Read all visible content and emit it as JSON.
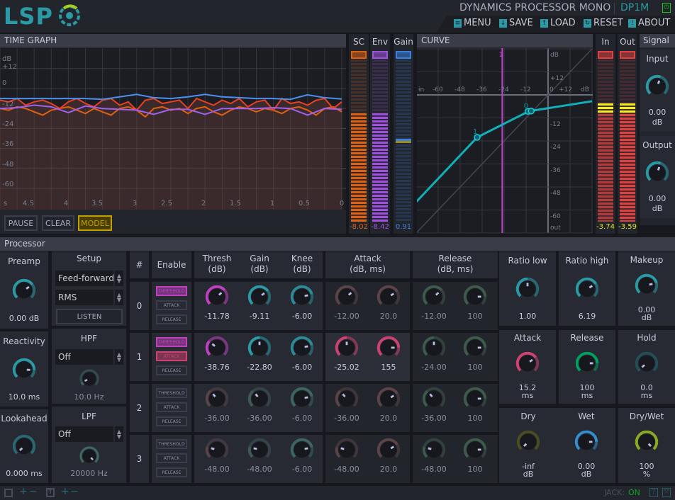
{
  "header": {
    "logo": "LSP",
    "title": "DYNAMICS PROCESSOR MONO",
    "code": "DP1M",
    "menu": [
      {
        "label": "MENU",
        "icon": "menu-icon"
      },
      {
        "label": "SAVE",
        "icon": "save-icon"
      },
      {
        "label": "LOAD",
        "icon": "load-icon"
      },
      {
        "label": "RESET",
        "icon": "reset-icon"
      },
      {
        "label": "ABOUT",
        "icon": "about-icon"
      }
    ],
    "power_color": "#20c020"
  },
  "time_graph": {
    "title": "TIME GRAPH",
    "y_labels": [
      "dB",
      "+12",
      "0",
      "-12",
      "-24",
      "-36",
      "-48",
      "-60"
    ],
    "x_labels": [
      "s",
      "4.5",
      "4",
      "3.5",
      "3",
      "2.5",
      "2",
      "1.5",
      "1",
      "0.5",
      "0"
    ],
    "x_range_s": [
      5,
      0
    ],
    "y_range_db": [
      -72,
      24
    ],
    "series": {
      "out": {
        "color": "#4a90f0",
        "values": [
          -6,
          -6,
          -6,
          -6,
          -6,
          -6,
          -6.5,
          -5,
          -3.5,
          -5.5,
          -6,
          -5,
          -3.5,
          -5,
          -5.5,
          -6,
          -6,
          -6.5,
          -3.8,
          -5.5,
          -6.3
        ]
      },
      "env": {
        "color": "#a060f0",
        "values": [
          -12,
          -11.5,
          -10,
          -11,
          -14.5,
          -10.5,
          -12,
          -12.5,
          -13,
          -15.5,
          -12.5,
          -12.5,
          -15.5,
          -12,
          -12,
          -12,
          -11.5,
          -12,
          -16,
          -12,
          -12.5
        ]
      },
      "in": {
        "color": "#e84020",
        "values": [
          -7,
          -8,
          -6,
          -10,
          -8,
          -7,
          -9,
          -12,
          -8,
          -6,
          -9,
          -11,
          -7,
          -6,
          -10,
          -8,
          -13,
          -7,
          -6,
          -9,
          -8,
          -7,
          -12,
          -6,
          -8,
          -10,
          -7,
          -9,
          -6,
          -11,
          -8,
          -7,
          -13,
          -6,
          -9,
          -8,
          -10,
          -7,
          -6,
          -12,
          -8
        ]
      },
      "sc": {
        "color": "#e06010",
        "values": [
          -12,
          -13,
          -11,
          -12,
          -14,
          -16,
          -13,
          -12,
          -11,
          -13,
          -15,
          -12,
          -14,
          -16,
          -12,
          -11,
          -13,
          -17,
          -12,
          -11,
          -13,
          -12,
          -15,
          -12,
          -11,
          -14,
          -16,
          -13,
          -11,
          -12,
          -14,
          -12,
          -13,
          -15,
          -12,
          -11,
          -13,
          -16,
          -12,
          -11,
          -14
        ]
      }
    },
    "buttons": {
      "pause": "PAUSE",
      "clear": "CLEAR",
      "model": "MODEL"
    }
  },
  "meters": {
    "sc": {
      "label": "SC",
      "value": "-8.02",
      "level": 0.67,
      "color": "#e06010"
    },
    "env": {
      "label": "Env",
      "value": "-8.42",
      "level": 0.67,
      "color": "#a050e0"
    },
    "gain": {
      "label": "Gain",
      "value": "0.91",
      "level": 0.51,
      "color": "#3a80e0"
    },
    "in": {
      "label": "In",
      "value": "-3.74",
      "level": 0.73,
      "color": "#e04040"
    },
    "out": {
      "label": "Out",
      "value": "-3.59",
      "level": 0.73,
      "color": "#e04040"
    }
  },
  "curve": {
    "title": "CURVE",
    "x_labels": [
      "in",
      "-60",
      "-48",
      "-36",
      "-24",
      "-12",
      "0",
      "+12",
      "dB"
    ],
    "y_labels": [
      "dB",
      "+12",
      "-12",
      "-24",
      "-36",
      "-48",
      "-60",
      "out"
    ],
    "range_db": [
      -72,
      24
    ],
    "points": [
      [
        -72,
        -55.8
      ],
      [
        -38.7,
        -22.1
      ],
      [
        -10.5,
        -8.5
      ],
      [
        24,
        -3.3
      ]
    ],
    "handles": [
      {
        "label": "1",
        "in": -38.7,
        "out": -22.1
      },
      {
        "label": "0",
        "in": -11,
        "out": -8.6
      },
      {
        "label": "",
        "in": -9.2,
        "out": -8.4
      }
    ],
    "marker": {
      "label": "1",
      "in": -25.02,
      "color": "#c040d0"
    },
    "color": "#10b0b8"
  },
  "signal": {
    "title": "Signal",
    "input": {
      "label": "Input",
      "value": "0.00",
      "unit": "dB",
      "pos": 0.57,
      "color": "#2a9aa5"
    },
    "output": {
      "label": "Output",
      "value": "0.00",
      "unit": "dB",
      "pos": 0.57,
      "color": "#2a9aa5"
    }
  },
  "processor": {
    "title": "Processor",
    "preamp": {
      "label": "Preamp",
      "value": "0.00 dB",
      "pos": 0.7,
      "color": "#2a9aa5"
    },
    "reactivity": {
      "label": "Reactivity",
      "value": "10.0 ms",
      "pos": 0.84,
      "color": "#2a9aa5"
    },
    "lookahead": {
      "label": "Lookahead",
      "value": "0.000 ms",
      "pos": 0.0,
      "color": "#2a9aa5"
    },
    "setup": {
      "label": "Setup",
      "mode": "Feed-forward",
      "type": "RMS",
      "listen": "LISTEN"
    },
    "hpf": {
      "label": "HPF",
      "mode": "Off",
      "value": "10.0 Hz",
      "pos": 0.08,
      "color": "#3e6660"
    },
    "lpf": {
      "label": "LPF",
      "mode": "Off",
      "value": "20000 Hz",
      "pos": 1.0,
      "color": "#3e6660"
    },
    "columns": {
      "num": "#",
      "enable": "Enable",
      "thresh": "Thresh\n(dB)",
      "gain": "Gain\n(dB)",
      "knee": "Knee\n(dB)",
      "attack": "Attack\n(dB, ms)",
      "release": "Release\n(dB, ms)"
    },
    "enable_labels": [
      "THRESHOLD",
      "ATTACK",
      "RELEASE"
    ],
    "rows": [
      {
        "num": "0",
        "enabled": [
          true,
          false,
          false
        ],
        "thresh": {
          "value": "-11.78",
          "pos": 0.68
        },
        "gain": {
          "value": "-9.11",
          "pos": 0.7
        },
        "knee": {
          "value": "-6.00",
          "pos": 0.78
        },
        "att_db": {
          "value": "-12.00",
          "pos": 0.68
        },
        "att_ms": {
          "value": "20.0",
          "pos": 0.72
        },
        "rel_db": {
          "value": "-12.00",
          "pos": 0.68
        },
        "rel_ms": {
          "value": "100",
          "pos": 0.83
        }
      },
      {
        "num": "1",
        "enabled": [
          true,
          true,
          false
        ],
        "thresh": {
          "value": "-38.76",
          "pos": 0.31
        },
        "gain": {
          "value": "-22.80",
          "pos": 0.5
        },
        "knee": {
          "value": "-6.00",
          "pos": 0.78
        },
        "att_db": {
          "value": "-25.02",
          "pos": 0.5
        },
        "att_ms": {
          "value": "155",
          "pos": 0.83
        },
        "rel_db": {
          "value": "-24.00",
          "pos": 0.5
        },
        "rel_ms": {
          "value": "100",
          "pos": 0.83
        }
      },
      {
        "num": "2",
        "enabled": [
          false,
          false,
          false
        ],
        "thresh": {
          "value": "-36.00",
          "pos": 0.35
        },
        "gain": {
          "value": "-36.00",
          "pos": 0.35
        },
        "knee": {
          "value": "-6.00",
          "pos": 0.78
        },
        "att_db": {
          "value": "-36.00",
          "pos": 0.35
        },
        "att_ms": {
          "value": "20.0",
          "pos": 0.72
        },
        "rel_db": {
          "value": "-36.00",
          "pos": 0.35
        },
        "rel_ms": {
          "value": "100",
          "pos": 0.83
        }
      },
      {
        "num": "3",
        "enabled": [
          false,
          false,
          false
        ],
        "thresh": {
          "value": "-48.00",
          "pos": 0.22
        },
        "gain": {
          "value": "-48.00",
          "pos": 0.22
        },
        "knee": {
          "value": "-6.00",
          "pos": 0.78
        },
        "att_db": {
          "value": "-48.00",
          "pos": 0.22
        },
        "att_ms": {
          "value": "20.0",
          "pos": 0.72
        },
        "rel_db": {
          "value": "-48.00",
          "pos": 0.22
        },
        "rel_ms": {
          "value": "100",
          "pos": 0.83
        }
      }
    ],
    "colors": {
      "thresh_on": "#c040c0",
      "attack_on": "#d04070",
      "thresh_off": "#5a4448",
      "gain_on": "#2a9aa5",
      "gain_off": "#3e5a55",
      "knee": "#2a8a95",
      "knee_off": "#3e6660",
      "att_off": "#5a4448",
      "rel": "#3e5a4a"
    },
    "right": [
      {
        "key": "ratio-low",
        "label": "Ratio low",
        "value": "1.00",
        "unit": "",
        "pos": 0.5,
        "color": "#2a9aa5"
      },
      {
        "key": "ratio-high",
        "label": "Ratio high",
        "value": "6.19",
        "unit": "",
        "pos": 0.72,
        "color": "#2a9aa5"
      },
      {
        "key": "makeup",
        "label": "Makeup",
        "value": "0.00",
        "unit": "dB",
        "pos": 0.78,
        "color": "#2a9aa5"
      },
      {
        "key": "attack",
        "label": "Attack",
        "value": "15.2",
        "unit": "ms",
        "pos": 0.7,
        "color": "#d04070"
      },
      {
        "key": "release",
        "label": "Release",
        "value": "100",
        "unit": "ms",
        "pos": 0.83,
        "color": "#00a060"
      },
      {
        "key": "hold",
        "label": "Hold",
        "value": "0.0",
        "unit": "ms",
        "pos": 0.02,
        "color": "#1f6d75"
      },
      {
        "key": "dry",
        "label": "Dry",
        "value": "-inf",
        "unit": "dB",
        "pos": 0.0,
        "color": "#6a6a10"
      },
      {
        "key": "wet",
        "label": "Wet",
        "value": "0.00",
        "unit": "dB",
        "pos": 0.83,
        "color": "#3090d0"
      },
      {
        "key": "dry-wet",
        "label": "Dry/Wet",
        "value": "100",
        "unit": "%",
        "pos": 1.0,
        "color": "#8aaa20"
      }
    ]
  },
  "footer": {
    "jack_label": "JACK:",
    "jack_status": "ON",
    "help": "?"
  }
}
